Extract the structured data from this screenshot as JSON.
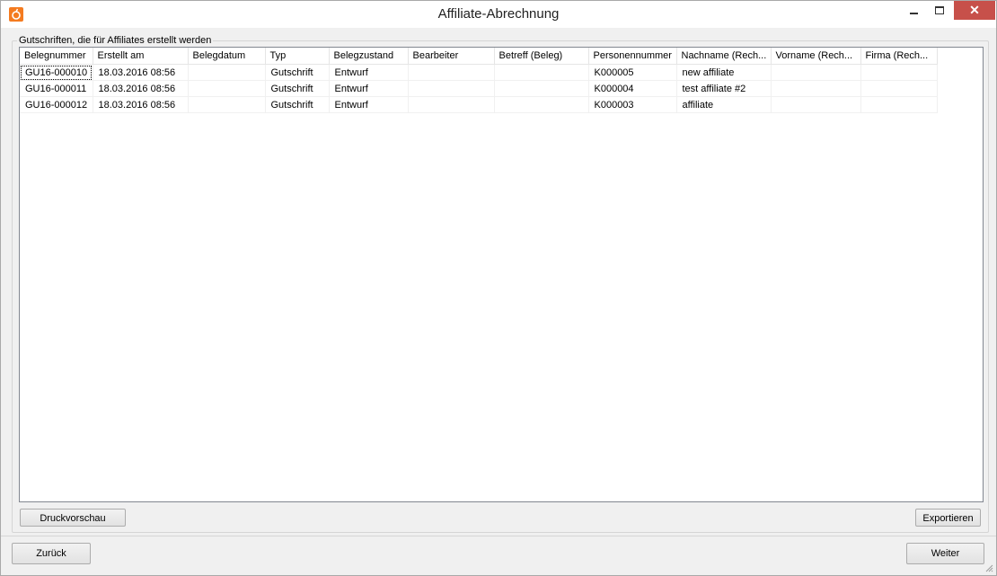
{
  "window": {
    "title": "Affiliate-Abrechnung"
  },
  "group": {
    "label": "Gutschriften, die für Affiliates erstellt werden"
  },
  "grid": {
    "columns": [
      "Belegnummer",
      "Erstellt am",
      "Belegdatum",
      "Typ",
      "Belegzustand",
      "Bearbeiter",
      "Betreff (Beleg)",
      "Personennummer",
      "Nachname (Rech...",
      "Vorname (Rech...",
      "Firma (Rech..."
    ],
    "rows": [
      [
        "GU16-000010",
        "18.03.2016 08:56",
        "",
        "Gutschrift",
        "Entwurf",
        "",
        "",
        "K000005",
        "new affiliate",
        "",
        ""
      ],
      [
        "GU16-000011",
        "18.03.2016 08:56",
        "",
        "Gutschrift",
        "Entwurf",
        "",
        "",
        "K000004",
        "test affiliate #2",
        "",
        ""
      ],
      [
        "GU16-000012",
        "18.03.2016 08:56",
        "",
        "Gutschrift",
        "Entwurf",
        "",
        "",
        "K000003",
        "affiliate",
        "",
        ""
      ]
    ]
  },
  "buttons": {
    "druckvorschau": "Druckvorschau",
    "exportieren": "Exportieren",
    "zurueck": "Zurück",
    "weiter": "Weiter"
  },
  "colors": {
    "close_button": "#c7504a",
    "app_icon": "#f47b20"
  }
}
